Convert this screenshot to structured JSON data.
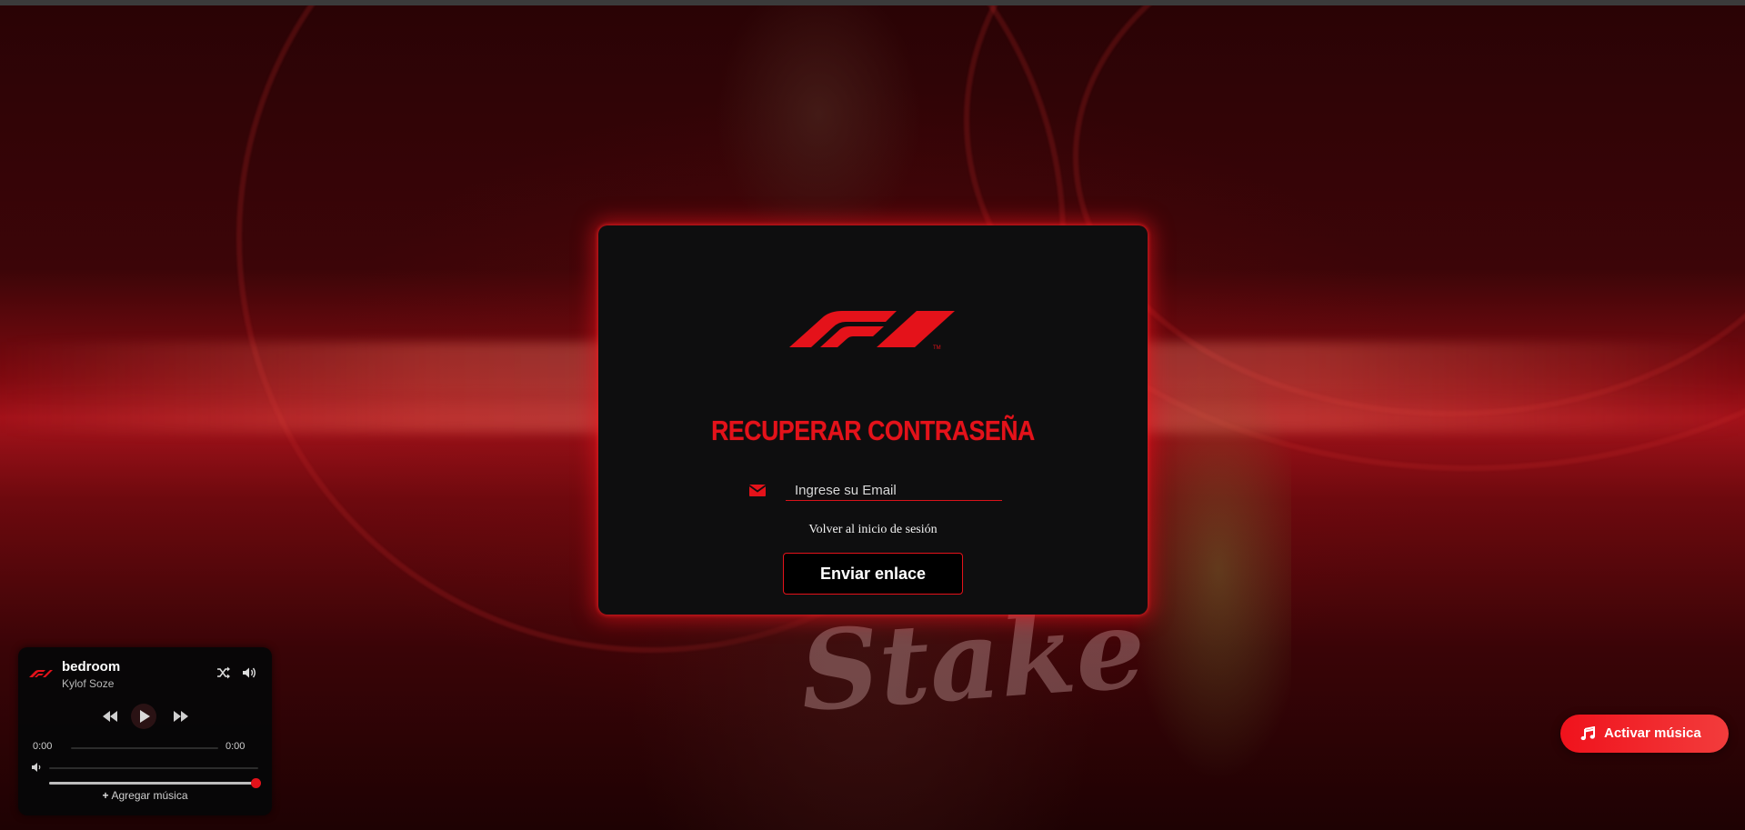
{
  "page": {
    "background_brand": "#e4121a"
  },
  "recover_card": {
    "logo_icon": "f1-logo-icon",
    "title": "RECUPERAR CONTRASEÑA",
    "email_icon": "envelope-icon",
    "email_placeholder": "Ingrese su Email",
    "email_value": "",
    "back_link": "Volver al inicio de sesión",
    "submit_label": "Enviar enlace"
  },
  "player": {
    "logo_icon": "f1-logo-icon",
    "track_title": "bedroom",
    "artist": "Kylof Soze",
    "shuffle_icon": "shuffle-icon",
    "volume_icon": "volume-icon",
    "prev_icon": "rewind-icon",
    "play_icon": "play-icon",
    "next_icon": "fast-forward-icon",
    "time_current": "0:00",
    "time_duration": "0:00",
    "progress": 0,
    "volume_level": 1.0,
    "add_music_label": "Agregar música"
  },
  "music_toggle": {
    "icon": "music-note-icon",
    "label": "Activar música"
  },
  "colors": {
    "accent": "#e4121a",
    "card_bg": "#0e0e0f"
  }
}
